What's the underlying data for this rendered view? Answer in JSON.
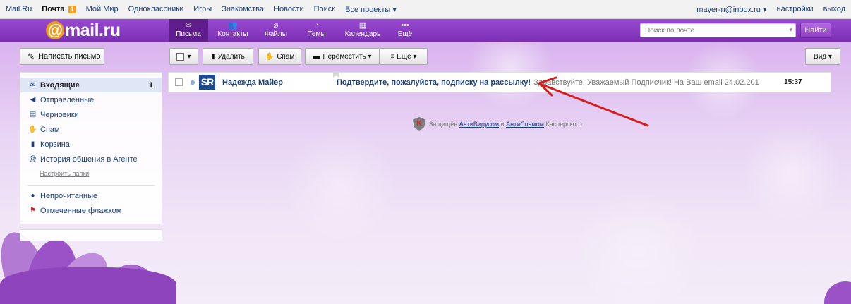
{
  "portal": {
    "links": [
      "Mail.Ru",
      "Почта",
      "Мой Мир",
      "Одноклассники",
      "Игры",
      "Знакомства",
      "Новости",
      "Поиск",
      "Все проекты ▾"
    ],
    "mail_count": "1",
    "user": "mayer-n@inbox.ru ▾",
    "settings": "настройки",
    "logout": "выход"
  },
  "header": {
    "logo_at": "@",
    "logo_text": "mail.ru",
    "tabs": [
      {
        "label": "Письма",
        "icon": "envelope-icon",
        "glyph": "✉"
      },
      {
        "label": "Контакты",
        "icon": "contacts-icon",
        "glyph": "👥"
      },
      {
        "label": "Файлы",
        "icon": "paperclip-icon",
        "glyph": "⌀"
      },
      {
        "label": "Темы",
        "icon": "palette-icon",
        "glyph": "◔"
      },
      {
        "label": "Календарь",
        "icon": "calendar-icon",
        "glyph": "▦"
      },
      {
        "label": "Ещё",
        "icon": "more-icon",
        "glyph": "•••"
      }
    ],
    "search_placeholder": "Поиск по почте",
    "search_button": "Найти"
  },
  "sidebar": {
    "compose": "Написать письмо",
    "folders": [
      {
        "label": "Входящие",
        "icon": "envelope-icon",
        "glyph": "✉",
        "count": "1"
      },
      {
        "label": "Отправленные",
        "icon": "reply-arrow-icon",
        "glyph": "◀"
      },
      {
        "label": "Черновики",
        "icon": "draft-icon",
        "glyph": "▤"
      },
      {
        "label": "Спам",
        "icon": "thumbs-down-icon",
        "glyph": "✋"
      },
      {
        "label": "Корзина",
        "icon": "trash-icon",
        "glyph": "▮"
      },
      {
        "label": "История общения в Агенте",
        "icon": "at-icon",
        "glyph": "@"
      }
    ],
    "folder_settings": "Настроить папки",
    "filters": [
      {
        "label": "Непрочитанные",
        "icon": "dot-icon",
        "glyph": "●",
        "color": "#1a3f7a"
      },
      {
        "label": "Отмеченные флажком",
        "icon": "flag-icon",
        "glyph": "⚑",
        "color": "#d8231f"
      }
    ]
  },
  "toolbar": {
    "select_glyph": "▾",
    "delete": "Удалить",
    "spam": "Спам",
    "move": "Переместить ▾",
    "more": "≡  Ещё ▾",
    "view": "Вид ▾"
  },
  "messages": [
    {
      "avatar": "SR",
      "sender": "Надежда Майер",
      "subject": "Подтвердите, пожалуйста, подписку на рассылку!",
      "snippet": "Здравствуйте, Уважаемый Подписчик! На Ваш email 24.02.201",
      "time": "15:37"
    }
  ],
  "protection": {
    "prefix": "Защищён",
    "antivirus": "АнтиВирусом",
    "and": "и",
    "antispam": "АнтиСпамом",
    "suffix": "Касперского",
    "logo_letter": "K"
  },
  "colors": {
    "brand_purple": "#8b3dc2",
    "brand_orange": "#f39a1b",
    "link_blue": "#1a3f7a",
    "annotation_red": "#d81b1b"
  }
}
